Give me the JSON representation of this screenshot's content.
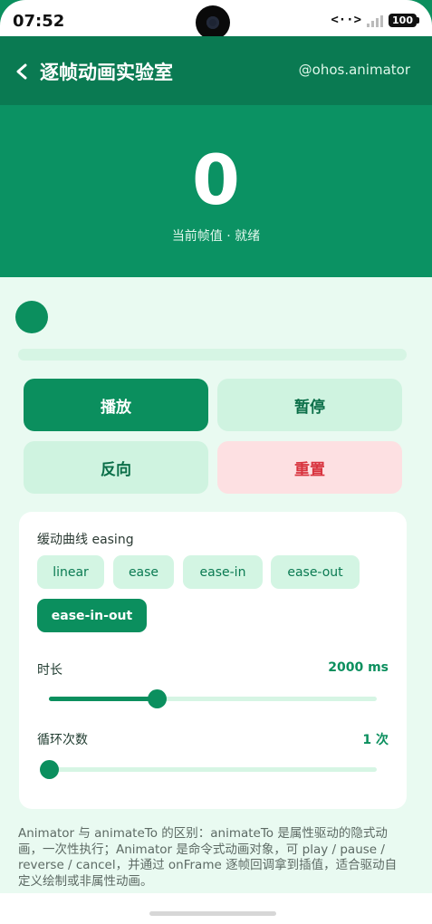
{
  "status_bar": {
    "time": "07:52",
    "nfc_text": "<··>",
    "battery": "100"
  },
  "app_bar": {
    "title": "逐帧动画实验室",
    "tag": "@ohos.animator",
    "back_icon": "chevron-left-icon"
  },
  "hero": {
    "frame_value": "0",
    "caption": "当前帧值 · 就绪"
  },
  "progress": {
    "value": 0
  },
  "controls": {
    "play": "播放",
    "pause": "暂停",
    "reverse": "反向",
    "reset": "重置"
  },
  "settings": {
    "easing_label": "缓动曲线 easing",
    "easing_options": [
      "linear",
      "ease",
      "ease-in",
      "ease-out",
      "ease-in-out"
    ],
    "easing_selected": "ease-in-out",
    "duration_label": "时长",
    "duration_value": "2000 ms",
    "duration_fraction": 0.33,
    "loops_label": "循环次数",
    "loops_value": "1 次",
    "loops_fraction": 0.0
  },
  "note": "Animator 与 animateTo 的区别：animateTo 是属性驱动的隐式动画，一次性执行；Animator 是命令式动画对象，可 play / pause / reverse / cancel，并通过 onFrame 逐帧回调拿到插值，适合驱动自定义绘制或非属性动画。",
  "colors": {
    "primary": "#0b8f5e",
    "app_bar": "#0a7a52",
    "content_bg": "#e9faf1",
    "chip_bg": "#d3f5e3",
    "danger_bg": "#fde0e2",
    "danger_text": "#d8323d"
  }
}
